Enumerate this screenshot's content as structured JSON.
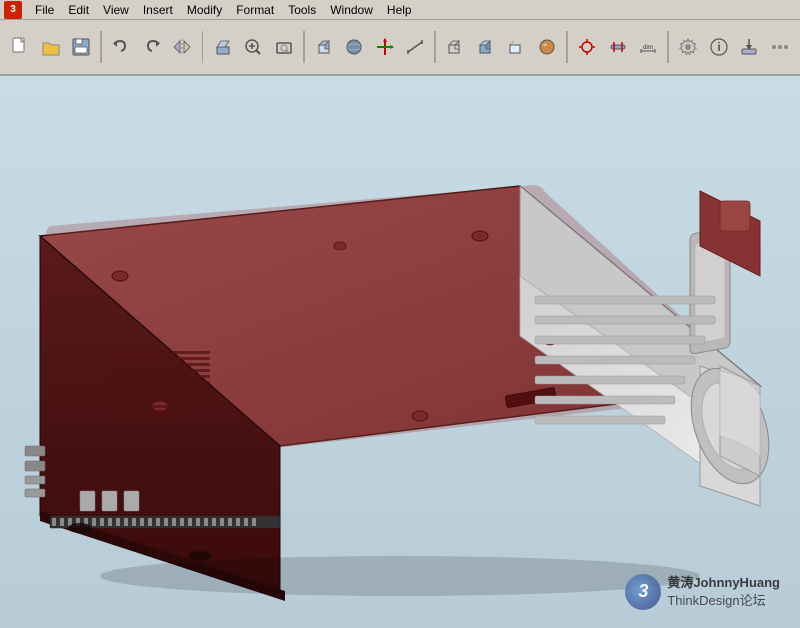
{
  "menubar": {
    "logo": "3",
    "items": [
      "File",
      "Edit",
      "View",
      "Insert",
      "Modify",
      "Format",
      "Tools",
      "Window",
      "Help"
    ]
  },
  "toolbar": {
    "groups": [
      [
        "new",
        "open",
        "save"
      ],
      [
        "undo",
        "redo",
        "mirror"
      ],
      [
        "extrude",
        "zoom-in",
        "zoom-fit"
      ],
      [
        "box",
        "sphere",
        "transform",
        "measure"
      ],
      [
        "wireframe",
        "shaded",
        "hidden",
        "rendered"
      ],
      [
        "snap",
        "constraint",
        "dimension"
      ],
      [
        "settings",
        "info",
        "export",
        "more"
      ]
    ]
  },
  "viewport": {
    "background_color": "#c8dce8"
  },
  "watermark": {
    "number": "3",
    "line1": "黄涛JohnnyHuang",
    "line2": "ThinkDesign论坛"
  }
}
